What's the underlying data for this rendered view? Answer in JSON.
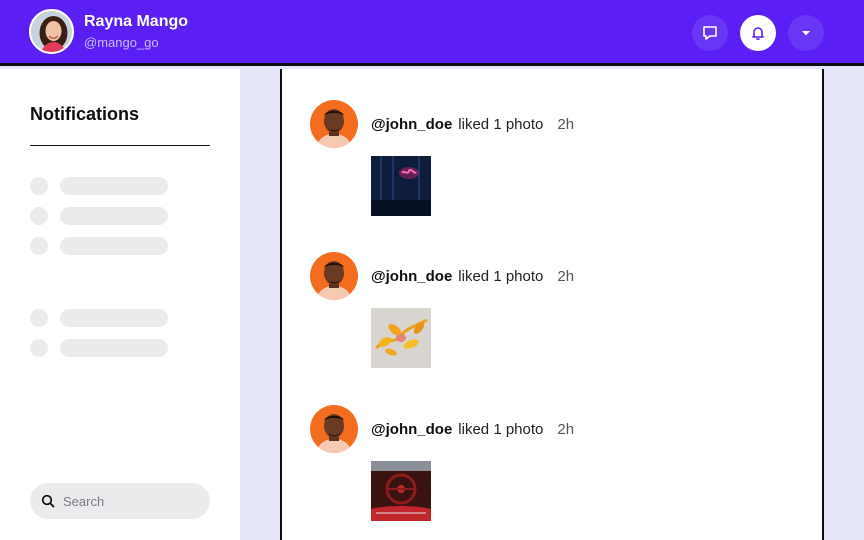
{
  "header": {
    "user_name": "Rayna Mango",
    "user_handle": "@mango_go",
    "icons": [
      "chat-icon",
      "bell-icon",
      "caret-down-icon"
    ]
  },
  "sidebar": {
    "title": "Notifications",
    "search_placeholder": "Search"
  },
  "notifications": [
    {
      "user": "@john_doe",
      "action": "liked 1 photo",
      "time": "2h",
      "thumbnail": "neon-sign-photo"
    },
    {
      "user": "@john_doe",
      "action": "liked 1 photo",
      "time": "2h",
      "thumbnail": "orange-flowers-photo"
    },
    {
      "user": "@john_doe",
      "action": "liked 1 photo",
      "time": "2h",
      "thumbnail": "car-interior-photo"
    }
  ],
  "colors": {
    "brand": "#5b1ff5",
    "avatar_bg": "#f36d21",
    "skeleton": "#ebebee",
    "page_bg": "#e6e6fb"
  }
}
